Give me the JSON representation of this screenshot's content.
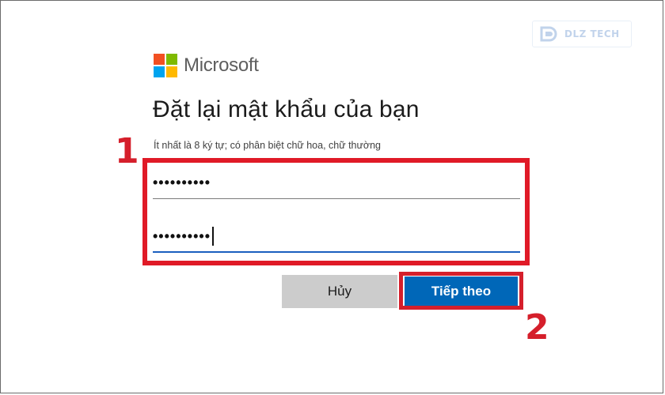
{
  "watermark": {
    "text": "DLZ TECH",
    "color": "#8fb0dc"
  },
  "logo": {
    "text": "Microsoft",
    "icon": "microsoft-logo-icon"
  },
  "form": {
    "title": "Đặt lại mật khẩu của bạn",
    "hint": "Ít nhất là 8 ký tự; có phân biệt chữ hoa, chữ thường",
    "password_mask": "••••••••••",
    "confirm_mask": "••••••••••"
  },
  "buttons": {
    "cancel_label": "Hủy",
    "next_label": "Tiếp theo"
  },
  "annotations": {
    "marker_1": "1",
    "marker_2": "2",
    "highlight_color": "#e01a27"
  },
  "colors": {
    "primary": "#0067b8",
    "cancel_bg": "#cccccc"
  }
}
